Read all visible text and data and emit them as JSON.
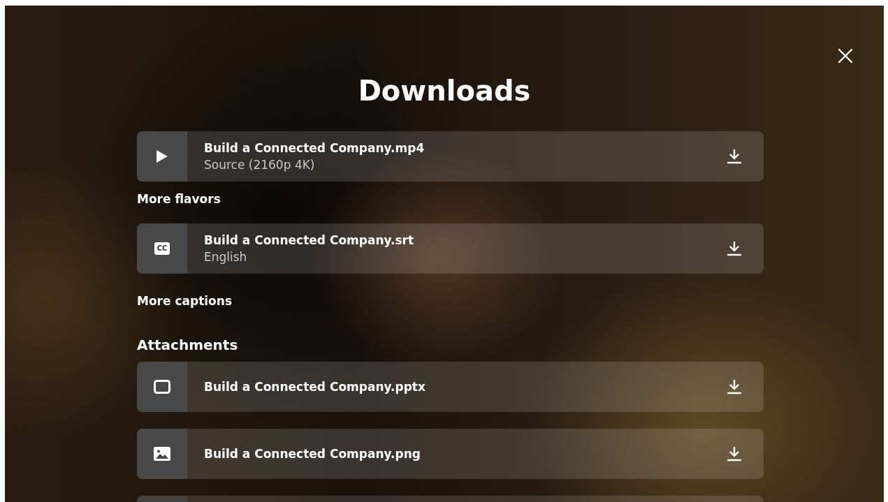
{
  "dialog": {
    "title": "Downloads"
  },
  "video": {
    "files": [
      {
        "kind": "video",
        "name": "Build a Connected Company.mp4",
        "detail": "Source (2160p 4K)"
      }
    ],
    "more_link": "More flavors"
  },
  "captions": {
    "files": [
      {
        "kind": "caption",
        "badge": "CC",
        "name": "Build a Connected Company.srt",
        "detail": "English"
      }
    ],
    "more_link": "More captions"
  },
  "attachments": {
    "heading": "Attachments",
    "files": [
      {
        "kind": "presentation",
        "name": "Build a Connected Company.pptx"
      },
      {
        "kind": "picture",
        "name": "Build a Connected Company.png"
      },
      {
        "kind": "partial"
      }
    ]
  }
}
